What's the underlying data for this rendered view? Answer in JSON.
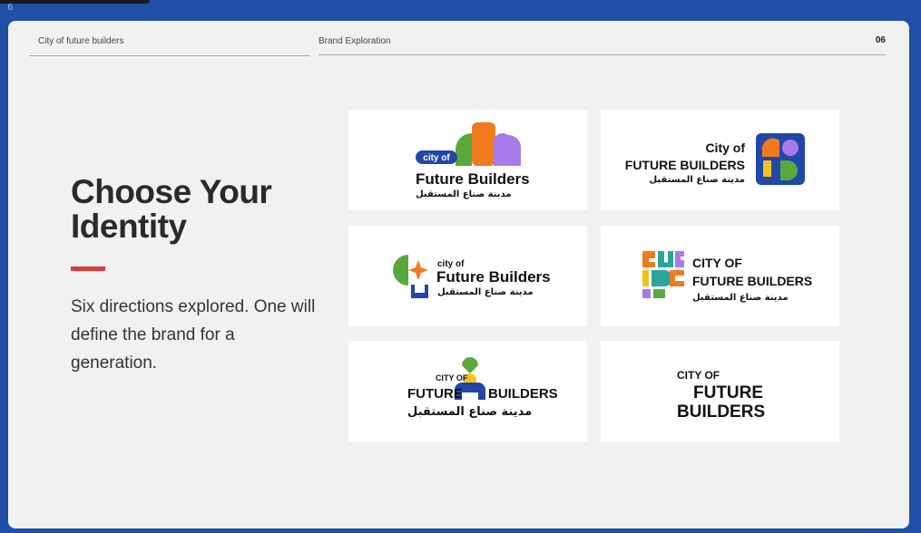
{
  "slide_index": "6",
  "header": {
    "left": "City of future builders",
    "middle": "Brand Exploration",
    "page_number": "06"
  },
  "main": {
    "title_line1": "Choose Your",
    "title_line2": "Identity",
    "subtitle": "Six directions explored. One will define the brand for a generation."
  },
  "logos": {
    "l1": {
      "badge": "city of",
      "name": "Future Builders",
      "arabic": "مدينة صناع المستقبل"
    },
    "l2": {
      "top": "City of",
      "name": "FUTURE BUILDERS",
      "arabic": "مدينة صناع المستقبل"
    },
    "l3": {
      "top": "city of",
      "name": "Future Builders",
      "arabic": "مدينة صناع المستقبل"
    },
    "l4": {
      "line1": "CITY OF",
      "line2": "FUTURE BUILDERS",
      "arabic": "مدينة صناع المستقبل"
    },
    "l5": {
      "top": "CITY OF",
      "left": "FUTURE",
      "right": "BUILDERS",
      "arabic": "مدينة صناع المستقبل"
    },
    "l6": {
      "line1": "CITY OF",
      "line2": "FUTURE",
      "line3": "BUILDERS"
    }
  },
  "colors": {
    "background": "#1f4fa6",
    "slide": "#f1f1f1",
    "accent_red": "#e23b3b",
    "blue": "#2247a8",
    "green": "#5aa83c",
    "orange": "#f07a1e",
    "purple": "#a77be8",
    "yellow": "#f4c21c",
    "teal": "#2aa4a0"
  }
}
